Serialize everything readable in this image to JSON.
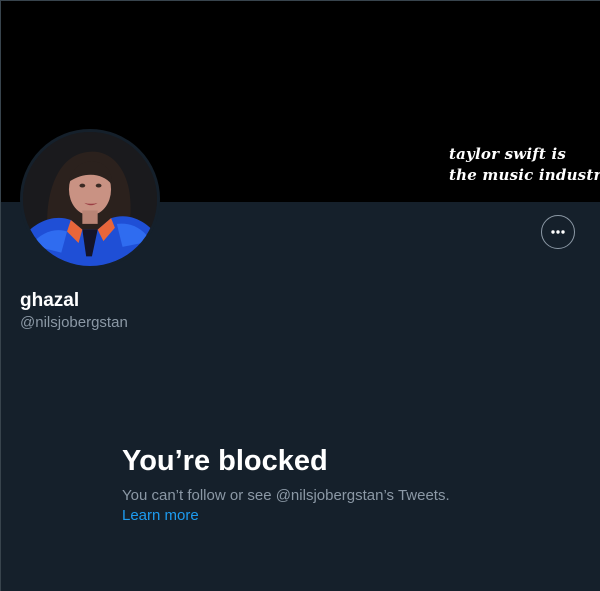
{
  "banner": {
    "line1": "taylor swift is",
    "line2": "the music industry",
    "background_color": "#000000"
  },
  "profile": {
    "display_name": "ghazal",
    "handle": "@nilsjobergstan",
    "avatar_icon": "profile-photo"
  },
  "actions": {
    "more_icon": "ellipsis-icon"
  },
  "blocked": {
    "title": "You’re blocked",
    "description": "You can’t follow or see @nilsjobergstan’s Tweets.",
    "learn_more": "Learn more"
  },
  "colors": {
    "background": "#15202b",
    "accent": "#1d9bf0",
    "secondary_text": "#8b98a5",
    "primary_text": "#ffffff"
  }
}
